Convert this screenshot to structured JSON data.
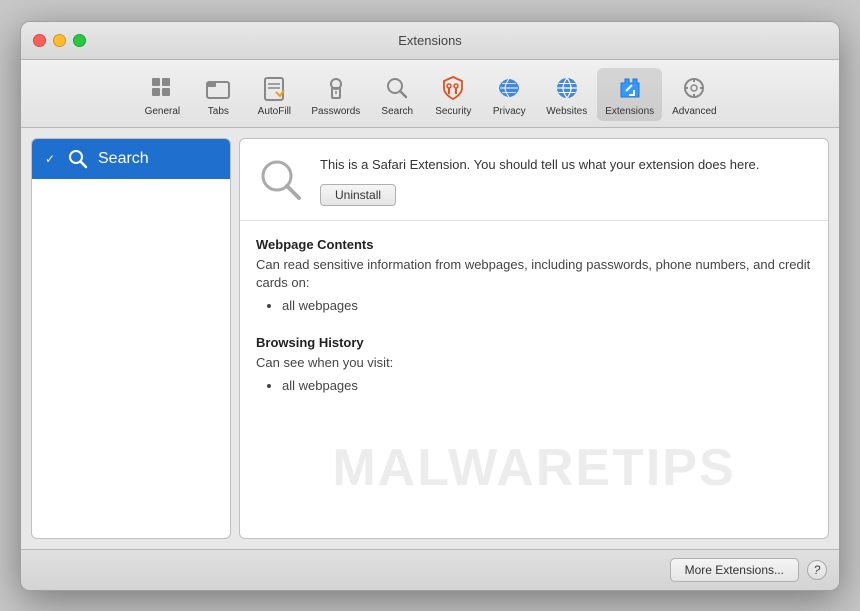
{
  "window": {
    "title": "Extensions"
  },
  "titlebar": {
    "buttons": {
      "close": "close",
      "minimize": "minimize",
      "maximize": "maximize"
    }
  },
  "toolbar": {
    "items": [
      {
        "id": "general",
        "label": "General",
        "icon": "general"
      },
      {
        "id": "tabs",
        "label": "Tabs",
        "icon": "tabs"
      },
      {
        "id": "autofill",
        "label": "AutoFill",
        "icon": "autofill"
      },
      {
        "id": "passwords",
        "label": "Passwords",
        "icon": "passwords"
      },
      {
        "id": "search",
        "label": "Search",
        "icon": "search"
      },
      {
        "id": "security",
        "label": "Security",
        "icon": "security"
      },
      {
        "id": "privacy",
        "label": "Privacy",
        "icon": "privacy"
      },
      {
        "id": "websites",
        "label": "Websites",
        "icon": "websites"
      },
      {
        "id": "extensions",
        "label": "Extensions",
        "icon": "extensions",
        "active": true
      },
      {
        "id": "advanced",
        "label": "Advanced",
        "icon": "advanced"
      }
    ]
  },
  "sidebar": {
    "extensions": [
      {
        "id": "search-ext",
        "label": "Search",
        "enabled": true,
        "selected": true
      }
    ]
  },
  "detail": {
    "description": "This is a Safari Extension. You should tell us what your extension does here.",
    "uninstall_button": "Uninstall",
    "permissions": [
      {
        "title": "Webpage Contents",
        "description": "Can read sensitive information from webpages, including passwords, phone numbers, and credit cards on:",
        "items": [
          "all webpages"
        ]
      },
      {
        "title": "Browsing History",
        "description": "Can see when you visit:",
        "items": [
          "all webpages"
        ]
      }
    ]
  },
  "footer": {
    "more_extensions_label": "More Extensions...",
    "help_label": "?"
  },
  "watermark": {
    "text": "MALWARETIPS"
  }
}
